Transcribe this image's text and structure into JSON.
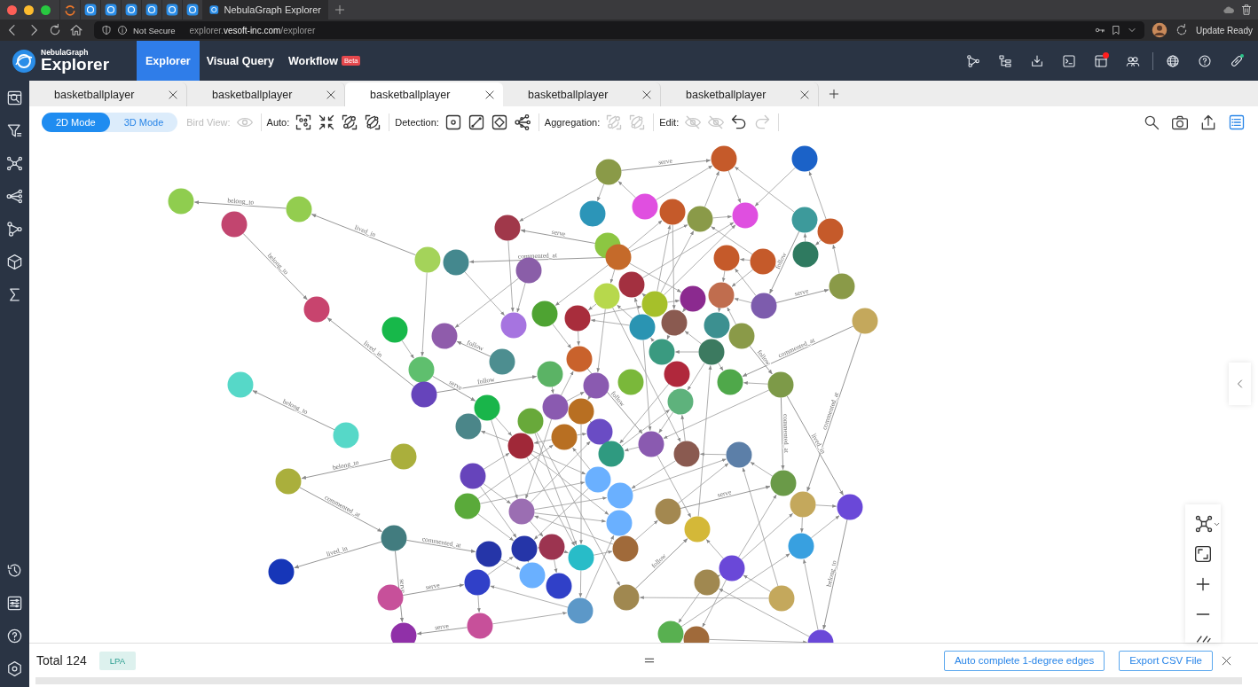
{
  "browser": {
    "pinned_tabs": [
      {
        "kind": "swirl"
      },
      {
        "kind": "nebula"
      },
      {
        "kind": "nebula"
      },
      {
        "kind": "nebula"
      },
      {
        "kind": "nebula"
      },
      {
        "kind": "nebula"
      },
      {
        "kind": "nebula"
      }
    ],
    "active_tab": {
      "title": "NebulaGraph Explorer"
    },
    "security": "Not Secure",
    "url": "explorer.**vesoft-inc.com**/explorer",
    "update": "Update Ready"
  },
  "header": {
    "logo": {
      "brand": "NebulaGraph",
      "product": "Explorer"
    },
    "nav": [
      {
        "label": "Explorer",
        "selected": true
      },
      {
        "label": "Visual Query",
        "selected": false
      },
      {
        "label": "Workflow",
        "selected": false,
        "badge": "Beta"
      }
    ],
    "tools": [
      {
        "kind": "path",
        "notification": false
      },
      {
        "kind": "tree",
        "notification": false
      },
      {
        "kind": "import",
        "notification": false
      },
      {
        "kind": "console",
        "notification": false
      },
      {
        "kind": "layout",
        "notification": true
      },
      {
        "kind": "people",
        "notification": false
      }
    ],
    "system": [
      {
        "kind": "globe",
        "online": false
      },
      {
        "kind": "help",
        "online": false
      },
      {
        "kind": "plug",
        "online": true
      }
    ]
  },
  "sidebar": {
    "top": [
      {
        "kind": "query"
      },
      {
        "kind": "filter"
      },
      {
        "kind": "graph"
      },
      {
        "kind": "share"
      },
      {
        "kind": "path"
      },
      {
        "kind": "cube"
      },
      {
        "kind": "sigma"
      }
    ],
    "bottom": [
      {
        "kind": "history"
      },
      {
        "kind": "settings"
      },
      {
        "kind": "help"
      },
      {
        "kind": "gear"
      }
    ]
  },
  "tabs": [
    {
      "label": "basketballplayer",
      "selected": false
    },
    {
      "label": "basketballplayer",
      "selected": false
    },
    {
      "label": "basketballplayer",
      "selected": true
    },
    {
      "label": "basketballplayer",
      "selected": false
    },
    {
      "label": "basketballplayer",
      "selected": false
    }
  ],
  "toolbar": {
    "modes": [
      {
        "label": "2D Mode",
        "selected": true
      },
      {
        "label": "3D Mode",
        "selected": false
      }
    ],
    "groups": [
      {
        "label": "Bird View:",
        "disabled": true,
        "tools": [
          {
            "kind": "eye",
            "disabled": true
          }
        ]
      },
      {
        "label": "Auto:",
        "disabled": false,
        "tools": [
          {
            "kind": "focus",
            "disabled": false
          },
          {
            "kind": "shrink",
            "disabled": false
          },
          {
            "kind": "link-a",
            "disabled": false
          },
          {
            "kind": "link-b",
            "disabled": false
          }
        ]
      },
      {
        "label": "Detection:",
        "disabled": false,
        "tools": [
          {
            "kind": "detect-circle",
            "disabled": false
          },
          {
            "kind": "detect-line",
            "disabled": false
          },
          {
            "kind": "detect-diamond",
            "disabled": false
          },
          {
            "kind": "network",
            "disabled": false
          }
        ]
      },
      {
        "label": "Aggregation:",
        "disabled": false,
        "tools": [
          {
            "kind": "link-a",
            "disabled": true
          },
          {
            "kind": "link-b",
            "disabled": true
          }
        ]
      },
      {
        "label": "Edit:",
        "disabled": false,
        "tools": [
          {
            "kind": "hide",
            "disabled": true
          },
          {
            "kind": "hide",
            "disabled": true
          },
          {
            "kind": "undo",
            "disabled": false
          },
          {
            "kind": "redo",
            "disabled": true
          }
        ]
      }
    ],
    "actions": [
      {
        "kind": "search",
        "selected": false
      },
      {
        "kind": "camera",
        "selected": false
      },
      {
        "kind": "export",
        "selected": false
      },
      {
        "kind": "list",
        "selected": true
      }
    ]
  },
  "graph": {
    "nodes": [
      {
        "color": "#8fcd4f"
      },
      {
        "color": "#c2456f"
      },
      {
        "color": "#93cd4f"
      },
      {
        "color": "#c8446e"
      },
      {
        "color": "#17b84a"
      },
      {
        "color": "#56d8c8"
      },
      {
        "color": "#56d8c8"
      },
      {
        "color": "#aaaf3c"
      },
      {
        "color": "#aaaf3c"
      },
      {
        "color": "#427c7f"
      },
      {
        "color": "#1636b8"
      },
      {
        "color": "#c7509a"
      },
      {
        "color": "#9030a8"
      },
      {
        "color": "#a4d35a"
      },
      {
        "color": "#44888e"
      },
      {
        "color": "#a0384a"
      },
      {
        "color": "#8a5ea8"
      },
      {
        "color": "#8f5cab"
      },
      {
        "color": "#5fbf6e"
      },
      {
        "color": "#6644bb"
      },
      {
        "color": "#19b54a"
      },
      {
        "color": "#4b8689"
      },
      {
        "color": "#4d8e90"
      },
      {
        "color": "#a674e0"
      },
      {
        "color": "#4ea332"
      },
      {
        "color": "#a82d3c"
      },
      {
        "color": "#5bb365"
      },
      {
        "color": "#c9622c"
      },
      {
        "color": "#8a5ab0"
      },
      {
        "color": "#8a9a48"
      },
      {
        "color": "#2c95b8"
      },
      {
        "color": "#8cc642"
      },
      {
        "color": "#c56a2a"
      },
      {
        "color": "#e04fe0"
      },
      {
        "color": "#c55a2a"
      },
      {
        "color": "#8a9a48"
      },
      {
        "color": "#df4fe0"
      },
      {
        "color": "#c55a2a"
      },
      {
        "color": "#1b62c8"
      },
      {
        "color": "#3d9a9b"
      },
      {
        "color": "#c55a2a"
      },
      {
        "color": "#2f7a60"
      },
      {
        "color": "#c55a2a"
      },
      {
        "color": "#c55a2a"
      },
      {
        "color": "#8a9a48"
      },
      {
        "color": "#c4a85c"
      },
      {
        "color": "#b7d84c"
      },
      {
        "color": "#a33040"
      },
      {
        "color": "#a6c02a"
      },
      {
        "color": "#8b2a8f"
      },
      {
        "color": "#c06d4e"
      },
      {
        "color": "#7d5cad"
      },
      {
        "color": "#2a94b2"
      },
      {
        "color": "#8a5a50"
      },
      {
        "color": "#3c9090"
      },
      {
        "color": "#8a9a48"
      },
      {
        "color": "#3a9a80"
      },
      {
        "color": "#3c7a60"
      },
      {
        "color": "#b0283c"
      },
      {
        "color": "#7ab83a"
      },
      {
        "color": "#5eb27c"
      },
      {
        "color": "#4fa84a"
      },
      {
        "color": "#7d9a48"
      },
      {
        "color": "#b86f22"
      },
      {
        "color": "#68a93a"
      },
      {
        "color": "#8a5ab0"
      },
      {
        "color": "#b86f22"
      },
      {
        "color": "#a02838"
      },
      {
        "color": "#6a4cc4"
      },
      {
        "color": "#2f9a80"
      },
      {
        "color": "#8a5ab0"
      },
      {
        "color": "#8a5a50"
      },
      {
        "color": "#5c7fa8"
      },
      {
        "color": "#6644bb"
      },
      {
        "color": "#5aaa3a"
      },
      {
        "color": "#9b6eb2"
      },
      {
        "color": "#6ab0ff"
      },
      {
        "color": "#6ab0ff"
      },
      {
        "color": "#6ab0ff"
      },
      {
        "color": "#a38850"
      },
      {
        "color": "#d4b838"
      },
      {
        "color": "#6a9a48"
      },
      {
        "color": "#c4a85c"
      },
      {
        "color": "#6a48d8"
      },
      {
        "color": "#38a0e0"
      },
      {
        "color": "#2535a8"
      },
      {
        "color": "#2535a8"
      },
      {
        "color": "#9c3450"
      },
      {
        "color": "#6ab0ff"
      },
      {
        "color": "#3040c8"
      },
      {
        "color": "#28bcc8"
      },
      {
        "color": "#a06a3a"
      },
      {
        "color": "#3040c8"
      },
      {
        "color": "#c7509a"
      },
      {
        "color": "#5c98c8"
      },
      {
        "color": "#a08850"
      },
      {
        "color": "#a08850"
      },
      {
        "color": "#6a48d8"
      },
      {
        "color": "#c4a85c"
      },
      {
        "color": "#58b050"
      },
      {
        "color": "#a06a3a"
      },
      {
        "color": "#6a48d8"
      }
    ],
    "edges": [
      {
        "label": "belong_to"
      },
      {
        "label": "belong_to"
      },
      {
        "label": "lived_in"
      },
      {
        "label": "belong_to"
      },
      {
        "label": "belong_to"
      },
      {
        "label": "lived_in"
      },
      {
        "label": "lived_in"
      },
      {
        "label": "serve"
      },
      {
        "label": "commented_at"
      },
      {
        "label": "serve"
      },
      {
        "label": "lived_in"
      },
      {
        "label": "commented_at"
      },
      {
        "label": "belong_to"
      },
      {
        "label": "commented_at"
      },
      {
        "label": "serve"
      },
      {
        "label": "commented_at"
      },
      {
        "label": "serve"
      },
      {
        "label": "follow"
      },
      {
        "label": "follow"
      },
      {
        "label": "serve"
      },
      {
        "label": "serve"
      },
      {
        "label": "follow"
      },
      {
        "label": "follow"
      },
      {
        "label": "commented_at"
      },
      {
        "label": "serve"
      },
      {
        "label": "serve"
      },
      {
        "label": "commented_at"
      },
      {
        "label": "follow"
      },
      {
        "label": "follow"
      }
    ]
  },
  "canvas_controls": [
    {
      "kind": "graph-layout"
    },
    {
      "kind": "fit"
    },
    {
      "kind": "zoom-in"
    },
    {
      "kind": "zoom-out"
    },
    {
      "kind": "brush"
    }
  ],
  "side_toggle": {
    "kind": "chevron-left"
  },
  "footer": {
    "total": "Total 124",
    "tag": "LPA",
    "buttons": [
      "Auto complete 1-degree edges",
      "Export CSV File"
    ]
  }
}
